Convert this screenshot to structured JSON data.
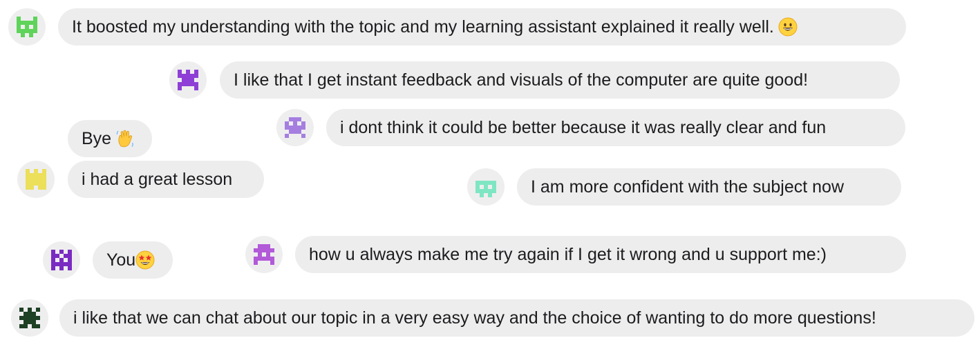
{
  "messages": [
    {
      "id": "m1",
      "text": "It boosted my understanding with the topic and my learning assistant explained it really well.",
      "emoji": "grinning-face-emoji",
      "avatar": {
        "icon": "space-invader-green-icon",
        "color": "#5fd35a"
      }
    },
    {
      "id": "m2",
      "text": "I like that I get instant feedback and visuals of the computer are quite good!",
      "avatar": {
        "icon": "space-invader-purple-icon",
        "color": "#8e3fd6"
      }
    },
    {
      "id": "m3",
      "text": "i dont think it could be better because it was really clear and fun",
      "avatar": {
        "icon": "space-invader-lilac-icon",
        "color": "#a57ee0"
      }
    },
    {
      "id": "m4",
      "text": "Bye",
      "emoji": "waving-hand-emoji"
    },
    {
      "id": "m5",
      "text": "i had a great lesson",
      "avatar": {
        "icon": "space-invader-yellow-icon",
        "color": "#ecdf5a"
      }
    },
    {
      "id": "m6",
      "text": "I am more confident with the subject now",
      "avatar": {
        "icon": "space-invader-mint-icon",
        "color": "#7ee6c2"
      }
    },
    {
      "id": "m7",
      "text": "You",
      "emoji": "star-struck-emoji",
      "avatar": {
        "icon": "space-invader-violet-icon",
        "color": "#7a2bc2"
      }
    },
    {
      "id": "m8",
      "text": "how u always make me try again if I get it wrong and u support me:)",
      "avatar": {
        "icon": "space-invader-orchid-icon",
        "color": "#b25ad8"
      }
    },
    {
      "id": "m9",
      "text": "i like that we can chat about our topic in a very easy way and the choice of wanting to do more questions!",
      "avatar": {
        "icon": "space-invader-darkgreen-icon",
        "color": "#1e4024"
      }
    }
  ]
}
